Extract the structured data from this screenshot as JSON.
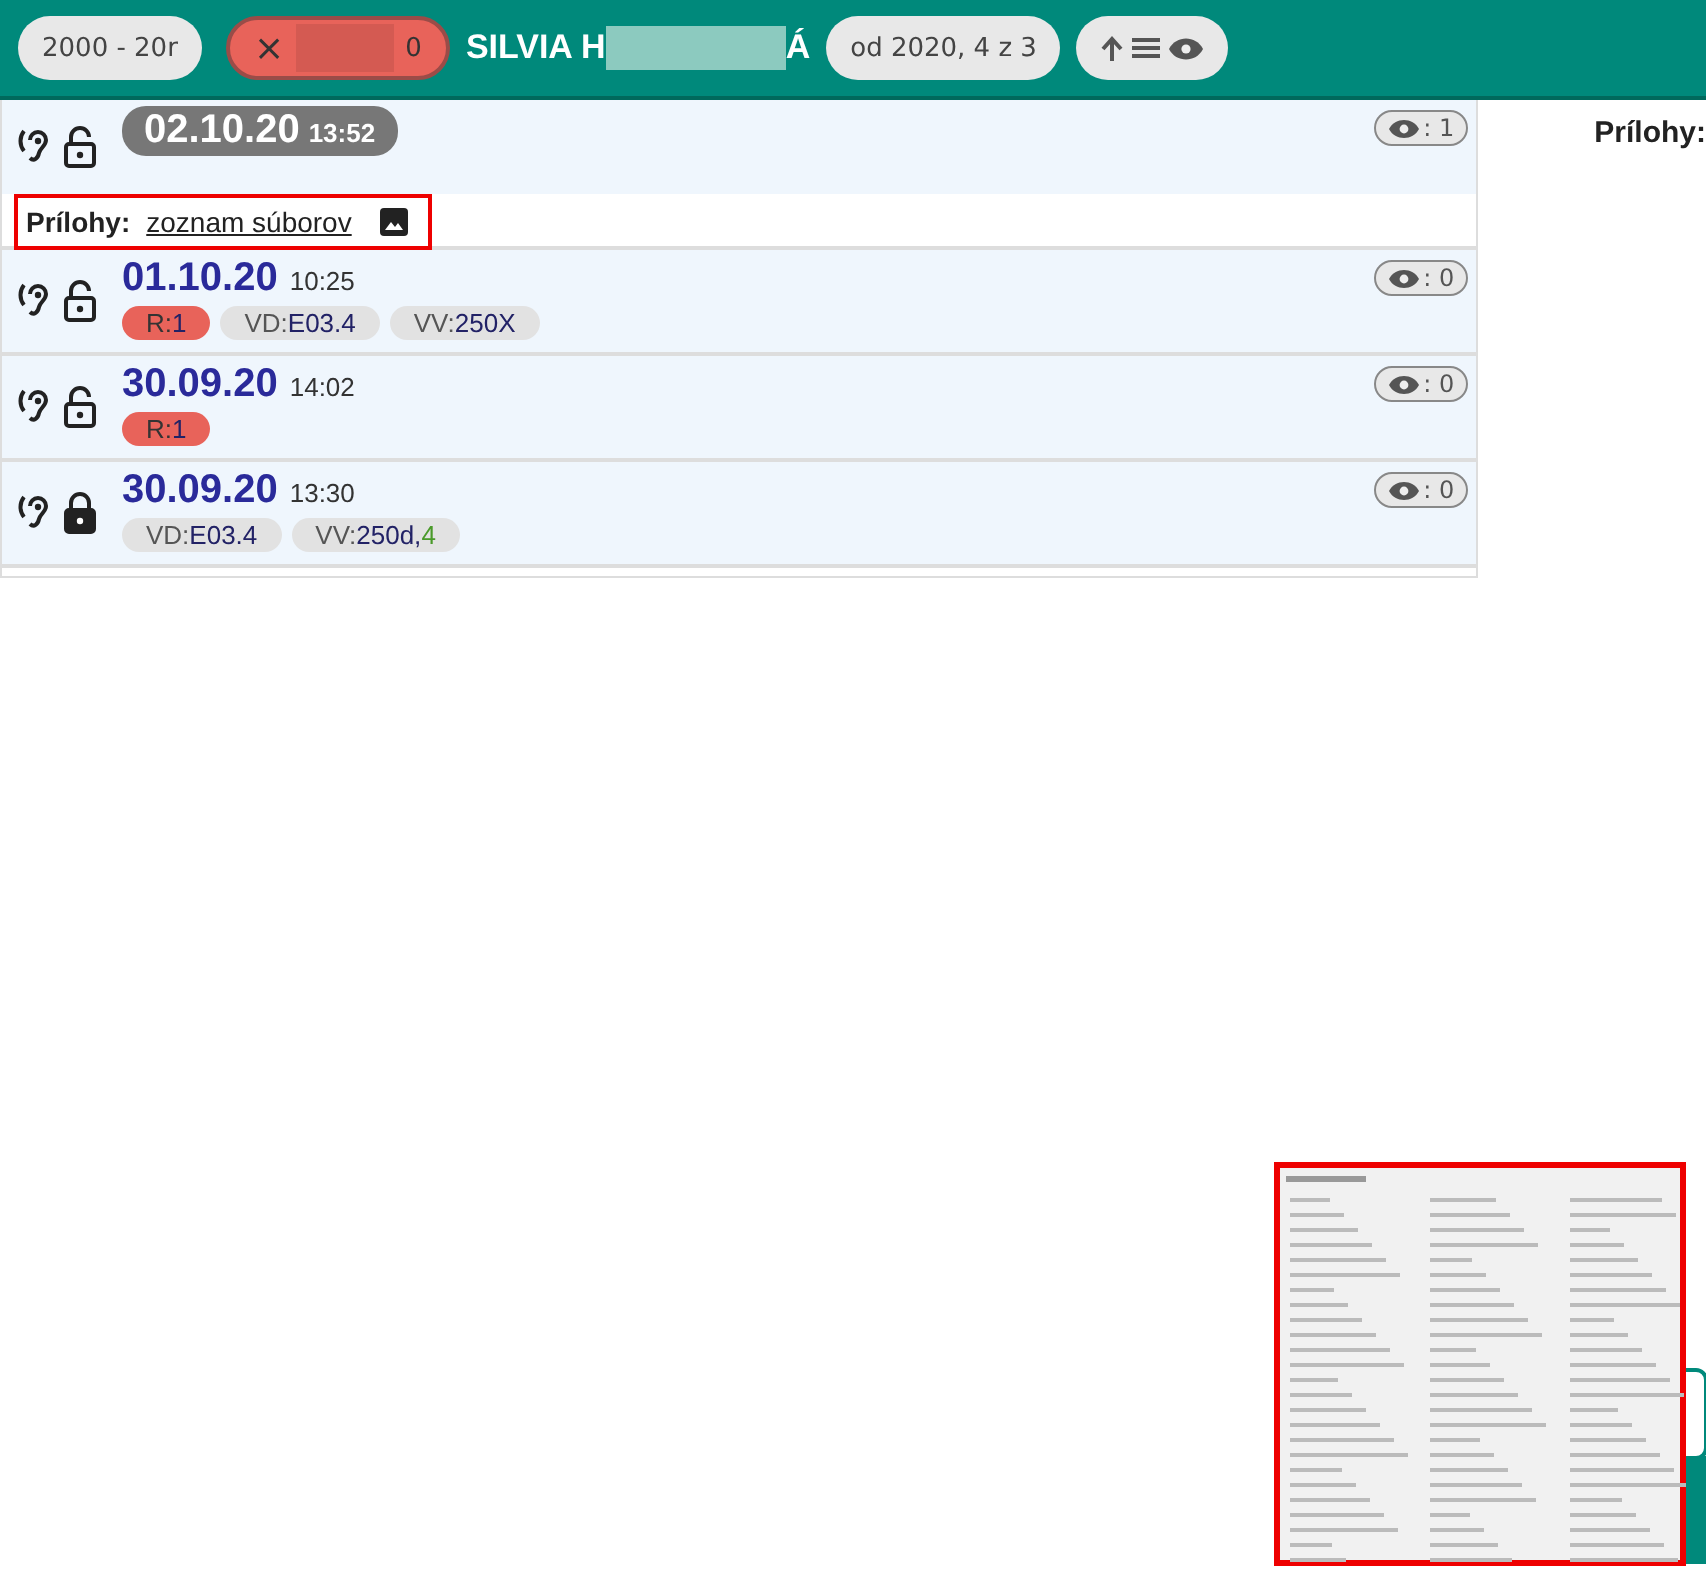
{
  "header": {
    "range_chip": "2000 - 20r",
    "filter_chip": {
      "close": "×",
      "count": "0"
    },
    "patient": {
      "first": "SILVIA H",
      "last": "Á"
    },
    "period_chip": "od 2020, 4 z 3"
  },
  "entries": [
    {
      "date": "02.10.20",
      "time": "13:52",
      "selected": true,
      "locked": false,
      "views": ": 1",
      "attachments": {
        "label": "Prílohy:",
        "link": "zoznam súborov"
      }
    },
    {
      "date": "01.10.20",
      "time": "10:25",
      "selected": false,
      "locked": false,
      "views": ": 0",
      "tags": [
        {
          "kind": "alert",
          "label": "R:",
          "value": "1"
        },
        {
          "kind": "code",
          "label": "VD:",
          "value": "E03.4"
        },
        {
          "kind": "code",
          "label": "VV:",
          "value": "250X"
        }
      ]
    },
    {
      "date": "30.09.20",
      "time": "14:02",
      "selected": false,
      "locked": false,
      "views": ": 0",
      "tags": [
        {
          "kind": "alert",
          "label": "R:",
          "value": "1"
        }
      ]
    },
    {
      "date": "30.09.20",
      "time": "13:30",
      "selected": false,
      "locked": true,
      "views": ": 0",
      "tags": [
        {
          "kind": "code",
          "label": "VD:",
          "value": "E03.4"
        },
        {
          "kind": "code",
          "label": "VV:",
          "value": "250d,",
          "note": "4"
        }
      ]
    }
  ],
  "side_panel": {
    "heading": "Prílohy:"
  }
}
